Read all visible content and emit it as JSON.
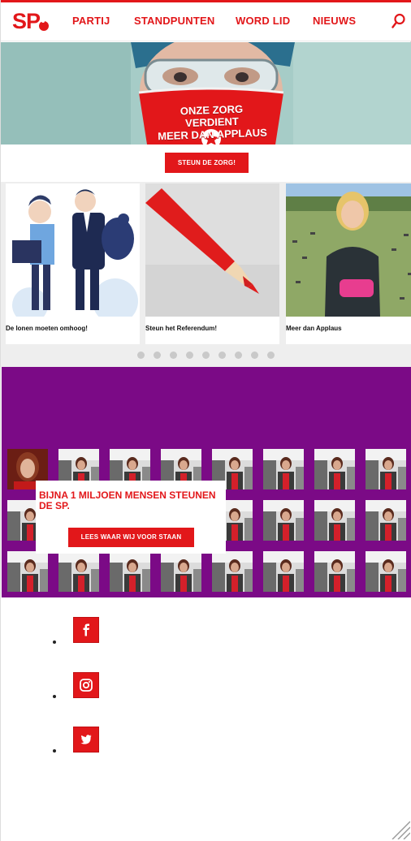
{
  "header": {
    "logo_text": "SP",
    "nav": [
      "PARTIJ",
      "STANDPUNTEN",
      "WORD LID",
      "NIEUWS"
    ],
    "accent_color": "#e2171a"
  },
  "hero": {
    "line1": "ONZE ZORG VERDIENT",
    "line2": "MEER DAN APPLAUS",
    "cta_label": "STEUN DE ZORG!"
  },
  "carousel": {
    "cards": [
      {
        "title": "De lonen moeten omhoog!"
      },
      {
        "title": "Steun het Referendum!"
      },
      {
        "title": "Meer dan Applaus"
      }
    ],
    "dot_count": 9
  },
  "promo": {
    "title": "BIJNA 1 MILJOEN MENSEN STEUNEN DE SP.",
    "button_label": "LEES WAAR WIJ VOOR STAAN",
    "background_color": "#7b0a86"
  },
  "social": {
    "icons": [
      "facebook-icon",
      "instagram-icon",
      "twitter-icon"
    ]
  }
}
